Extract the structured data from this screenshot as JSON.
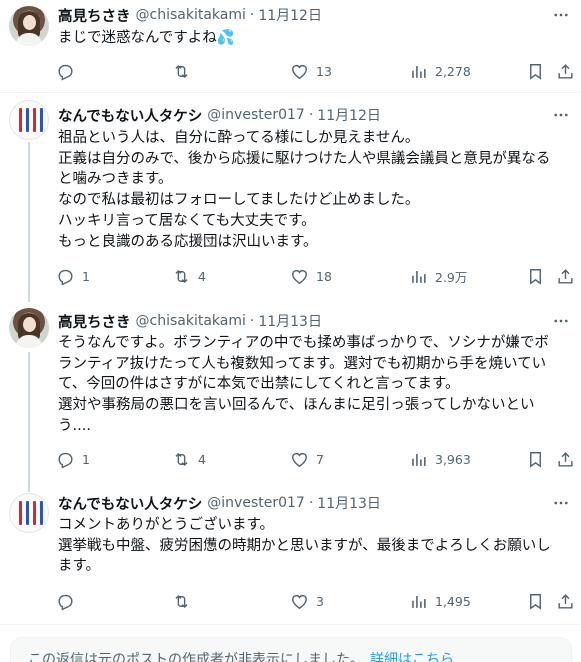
{
  "tweets": [
    {
      "name": "高見ちさき",
      "handle": "@chisakitakami",
      "separator": "·",
      "date": "11月12日",
      "lines": [
        "まじで迷惑なんですよね💦"
      ],
      "counts": {
        "reply": "",
        "retweet": "",
        "like": "13",
        "views": "2,278"
      }
    },
    {
      "name": "なんでもない人タケシ",
      "handle": "@invester017",
      "separator": "·",
      "date": "11月12日",
      "lines": [
        "祖品という人は、自分に酔ってる様にしか見えません。",
        "正義は自分のみで、後から応援に駆けつけた人や県議会議員と意見が異なる",
        "と噛みつきます。",
        "なので私は最初はフォローしてましたけど止めました。",
        "ハッキリ言って居なくても大丈夫です。",
        "もっと良識のある応援団は沢山います。"
      ],
      "counts": {
        "reply": "1",
        "retweet": "4",
        "like": "18",
        "views": "2.9万"
      }
    },
    {
      "name": "高見ちさき",
      "handle": "@chisakitakami",
      "separator": "·",
      "date": "11月13日",
      "lines": [
        "そうなんですよ。ボランティアの中でも揉め事ばっかりで、ソシナが嫌でボ",
        "ランティア抜けたって人も複数知ってます。選対でも初期から手を焼いてい",
        "て、今回の件はさすがに本気で出禁にしてくれと言ってます。",
        "選対や事務局の悪口を言い回るんで、ほんまに足引っ張ってしかないとい",
        "う...."
      ],
      "counts": {
        "reply": "1",
        "retweet": "4",
        "like": "7",
        "views": "3,963"
      }
    },
    {
      "name": "なんでもない人タケシ",
      "handle": "@invester017",
      "separator": "·",
      "date": "11月13日",
      "lines": [
        "コメントありがとうございます。",
        "選挙戦も中盤、疲労困憊の時期かと思いますが、最後までよろしくお願いし",
        "ます。"
      ],
      "counts": {
        "reply": "",
        "retweet": "",
        "like": "3",
        "views": "1,495"
      }
    }
  ],
  "hidden_notice": {
    "text": "この返信は元のポストの作成者が非表示にしました。",
    "link": "詳細はこちら"
  },
  "icons": [
    "more-icon",
    "reply-icon",
    "retweet-icon",
    "like-icon",
    "views-icon",
    "bookmark-icon",
    "share-icon"
  ],
  "colors": {
    "text": "#0f1419",
    "muted": "#536471",
    "link": "#1d9bf0",
    "divider": "#eff3f4",
    "thread": "#cfd9de"
  }
}
